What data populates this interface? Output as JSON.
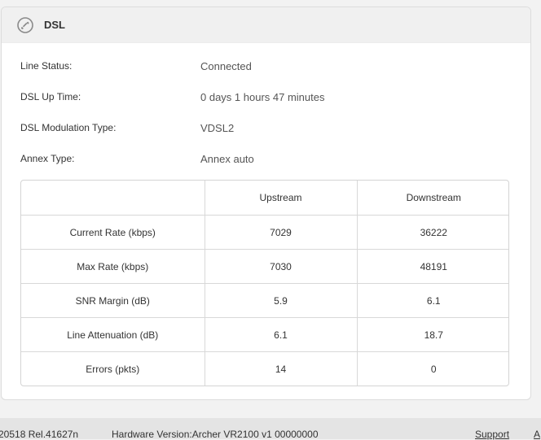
{
  "panel": {
    "title": "DSL",
    "icon": "phone-icon"
  },
  "info": [
    {
      "label": "Line Status:",
      "value": "Connected"
    },
    {
      "label": "DSL Up Time:",
      "value": "0 days 1 hours 47 minutes"
    },
    {
      "label": "DSL Modulation Type:",
      "value": "VDSL2"
    },
    {
      "label": "Annex Type:",
      "value": "Annex auto"
    }
  ],
  "table": {
    "headers": [
      "",
      "Upstream",
      "Downstream"
    ],
    "rows": [
      {
        "label": "Current Rate (kbps)",
        "upstream": "7029",
        "downstream": "36222"
      },
      {
        "label": "Max Rate (kbps)",
        "upstream": "7030",
        "downstream": "48191"
      },
      {
        "label": "SNR Margin (dB)",
        "upstream": "5.9",
        "downstream": "6.1"
      },
      {
        "label": "Line Attenuation (dB)",
        "upstream": "6.1",
        "downstream": "18.7"
      },
      {
        "label": "Errors (pkts)",
        "upstream": "14",
        "downstream": "0"
      }
    ]
  },
  "footer": {
    "firmware_fragment": "20518 Rel.41627n",
    "hardware": "Hardware Version:Archer VR2100 v1 00000000",
    "support_label": "Support",
    "cutoff_label": "A"
  }
}
